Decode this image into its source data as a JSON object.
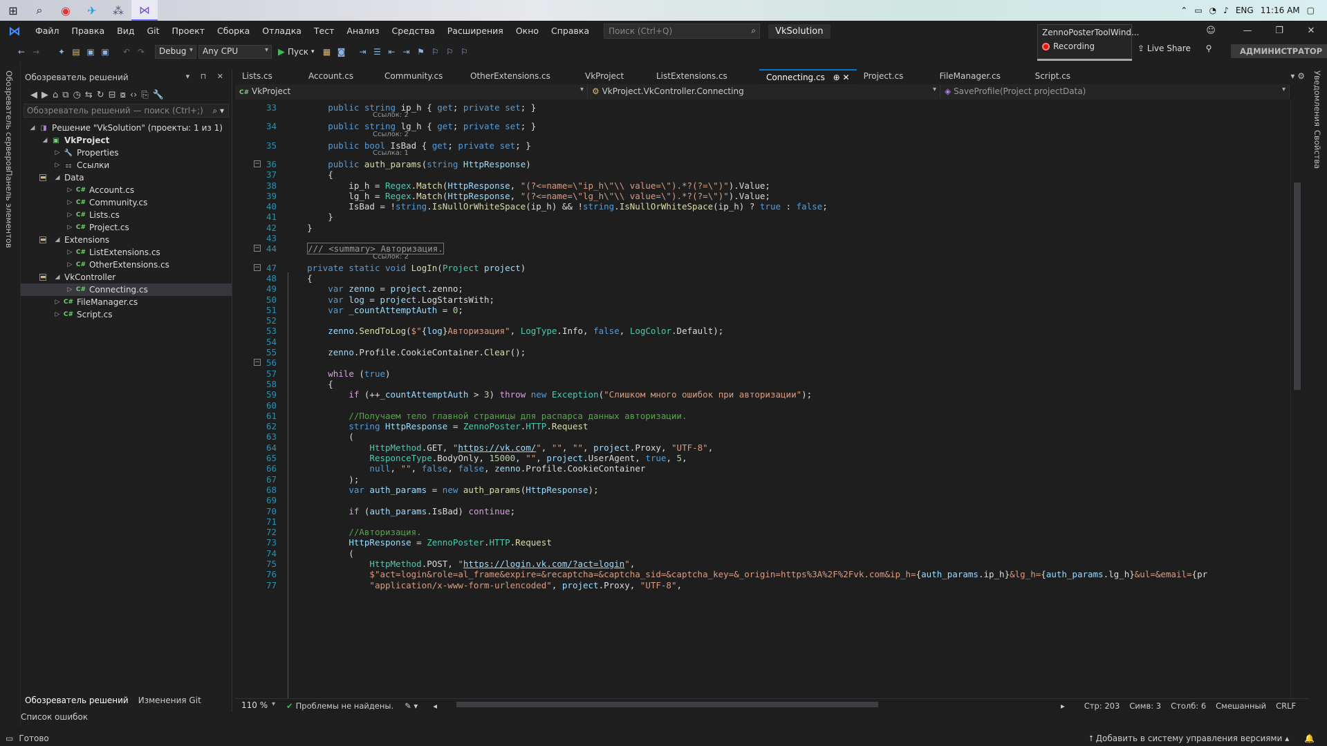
{
  "taskbar": {
    "tray": {
      "lang": "ENG",
      "time": "11:16 AM"
    }
  },
  "menubar": {
    "items": [
      "Файл",
      "Правка",
      "Вид",
      "Git",
      "Проект",
      "Сборка",
      "Отладка",
      "Тест",
      "Анализ",
      "Средства",
      "Расширения",
      "Окно",
      "Справка"
    ],
    "search_placeholder": "Поиск (Ctrl+Q)",
    "solution_name": "VkSolution"
  },
  "recording": {
    "title": "ZennoPosterToolWind...",
    "status": "Recording"
  },
  "toolbar": {
    "config": "Debug",
    "platform": "Any CPU",
    "run_label": "Пуск",
    "live_share": "Live Share",
    "admin": "АДМИНИСТРАТОР"
  },
  "left_strip": {
    "servers": "Обозреватель серверов",
    "toolbox": "Панель элементов"
  },
  "right_strip": {
    "notifications": "Уведомления",
    "properties": "Свойства"
  },
  "solution_explorer": {
    "title": "Обозреватель решений",
    "search_placeholder": "Обозреватель решений — поиск (Ctrl+;)",
    "tree": [
      {
        "label": "Решение \"VkSolution\" (проекты: 1 из 1)",
        "indent": 0,
        "icon": "sol",
        "arrow": "open"
      },
      {
        "label": "VkProject",
        "indent": 1,
        "icon": "proj",
        "arrow": "open",
        "bold": true
      },
      {
        "label": "Properties",
        "indent": 2,
        "icon": "wrench",
        "arrow": "closed"
      },
      {
        "label": "Ссылки",
        "indent": 2,
        "icon": "ref",
        "arrow": "closed"
      },
      {
        "label": "Data",
        "indent": 2,
        "icon": "fold",
        "arrow": "open"
      },
      {
        "label": "Account.cs",
        "indent": 3,
        "icon": "cs",
        "arrow": "closed"
      },
      {
        "label": "Community.cs",
        "indent": 3,
        "icon": "cs",
        "arrow": "closed"
      },
      {
        "label": "Lists.cs",
        "indent": 3,
        "icon": "cs",
        "arrow": "closed"
      },
      {
        "label": "Project.cs",
        "indent": 3,
        "icon": "cs",
        "arrow": "closed"
      },
      {
        "label": "Extensions",
        "indent": 2,
        "icon": "fold",
        "arrow": "open"
      },
      {
        "label": "ListExtensions.cs",
        "indent": 3,
        "icon": "cs",
        "arrow": "closed"
      },
      {
        "label": "OtherExtensions.cs",
        "indent": 3,
        "icon": "cs",
        "arrow": "closed"
      },
      {
        "label": "VkController",
        "indent": 2,
        "icon": "fold",
        "arrow": "open"
      },
      {
        "label": "Connecting.cs",
        "indent": 3,
        "icon": "cs",
        "arrow": "closed",
        "selected": true
      },
      {
        "label": "FileManager.cs",
        "indent": 2,
        "icon": "cs",
        "arrow": "closed"
      },
      {
        "label": "Script.cs",
        "indent": 2,
        "icon": "cs",
        "arrow": "closed"
      }
    ],
    "bottom_tabs": [
      "Обозреватель решений",
      "Изменения Git"
    ],
    "error_list": "Список ошибок"
  },
  "editor": {
    "tabs": [
      "Lists.cs",
      "Account.cs",
      "Community.cs",
      "OtherExtensions.cs",
      "VkProject",
      "ListExtensions.cs",
      "Connecting.cs",
      "Project.cs",
      "FileManager.cs",
      "Script.cs"
    ],
    "active_tab": "Connecting.cs",
    "nav": [
      "VkProject",
      "VkProject.VkController.Connecting",
      "SaveProfile(Project projectData)"
    ],
    "zoom": "110 %",
    "problems": "Проблемы не найдены.",
    "pos": {
      "line": "Стр: 203",
      "char": "Симв: 3",
      "col": "Столб: 6",
      "ws": "Смешанный",
      "eol": "CRLF"
    }
  },
  "code_lines": [
    {
      "n": "33",
      "lens": "Ссылок: 2",
      "html": "        <span class=\"kw\">public</span> <span class=\"kw\">string</span> ip_h { <span class=\"kw\">get</span>; <span class=\"kw\">private</span> <span class=\"kw\">set</span>; }"
    },
    {
      "n": "34",
      "lens": "Ссылок: 2",
      "html": "        <span class=\"kw\">public</span> <span class=\"kw\">string</span> lg_h { <span class=\"kw\">get</span>; <span class=\"kw\">private</span> <span class=\"kw\">set</span>; }"
    },
    {
      "n": "35",
      "lens": "Ссылка: 1",
      "html": "        <span class=\"kw\">public</span> <span class=\"kw\">bool</span> IsBad { <span class=\"kw\">get</span>; <span class=\"kw\">private</span> <span class=\"kw\">set</span>; }"
    },
    {
      "n": "36",
      "html": "        <span class=\"kw\">public</span> <span class=\"fn\">auth_params</span>(<span class=\"kw\">string</span> <span class=\"vr\">HttpResponse</span>)"
    },
    {
      "n": "37",
      "html": "        {"
    },
    {
      "n": "38",
      "html": "            ip_h = <span class=\"ty\">Regex</span>.<span class=\"fn\">Match</span>(<span class=\"vr\">HttpResponse</span>, <span class=\"st\">\"(?&lt;=name=\\\"ip_h\\\"\\\\ value=\\\").*?(?=\\\")\"</span>).Value;"
    },
    {
      "n": "39",
      "html": "            lg_h = <span class=\"ty\">Regex</span>.<span class=\"fn\">Match</span>(<span class=\"vr\">HttpResponse</span>, <span class=\"st\">\"(?&lt;=name=\\\"lg_h\\\"\\\\ value=\\\").*?(?=\\\")\"</span>).Value;"
    },
    {
      "n": "40",
      "html": "            IsBad = !<span class=\"kw\">string</span>.<span class=\"fn\">IsNullOrWhiteSpace</span>(ip_h) &amp;&amp; !<span class=\"kw\">string</span>.<span class=\"fn\">IsNullOrWhiteSpace</span>(ip_h) ? <span class=\"kw\">true</span> : <span class=\"kw\">false</span>;"
    },
    {
      "n": "41",
      "html": "        }"
    },
    {
      "n": "42",
      "html": "    }"
    },
    {
      "n": "43",
      "html": ""
    },
    {
      "n": "44",
      "lens": "Ссылок: 2",
      "html": "    <span style=\"border:1px solid #777;color:#999\">/// &lt;summary&gt; Авторизация.</span>"
    },
    {
      "n": "47",
      "html": "    <span class=\"kw\">private</span> <span class=\"kw\">static</span> <span class=\"kw\">void</span> <span class=\"fn\">LogIn</span>(<span class=\"ty\">Project</span> <span class=\"vr\">project</span>)"
    },
    {
      "n": "48",
      "html": "    {"
    },
    {
      "n": "49",
      "html": "        <span class=\"kw\">var</span> <span class=\"vr\">zenno</span> = <span class=\"vr\">project</span>.zenno;"
    },
    {
      "n": "50",
      "html": "        <span class=\"kw\">var</span> <span class=\"vr\">log</span> = <span class=\"vr\">project</span>.LogStartsWith;"
    },
    {
      "n": "51",
      "html": "        <span class=\"kw\">var</span> <span class=\"vr\">_countAttemptAuth</span> = <span class=\"nm\">0</span>;"
    },
    {
      "n": "52",
      "html": ""
    },
    {
      "n": "53",
      "html": "        <span class=\"vr\">zenno</span>.<span class=\"fn\">SendToLog</span>(<span class=\"st\">$\"</span>{<span class=\"vr\">log</span>}<span class=\"st\">Авторизация\"</span>, <span class=\"ty\">LogType</span>.Info, <span class=\"kw\">false</span>, <span class=\"ty\">LogColor</span>.Default);"
    },
    {
      "n": "54",
      "html": ""
    },
    {
      "n": "55",
      "html": "        <span class=\"vr\">zenno</span>.Profile.CookieContainer.<span class=\"fn\">Clear</span>();"
    },
    {
      "n": "56",
      "html": ""
    },
    {
      "n": "57",
      "html": "        <span class=\"ctl\">while</span> (<span class=\"kw\">true</span>)"
    },
    {
      "n": "58",
      "html": "        {"
    },
    {
      "n": "59",
      "html": "            <span class=\"ctl\">if</span> (++<span class=\"vr\">_countAttemptAuth</span> &gt; <span class=\"nm\">3</span>) <span class=\"ctl\">throw</span> <span class=\"kw\">new</span> <span class=\"ty\">Exception</span>(<span class=\"st\">\"Слишком много ошибок при авторизации\"</span>);"
    },
    {
      "n": "60",
      "html": ""
    },
    {
      "n": "61",
      "html": "            <span class=\"cm\">//Получаем тело главной страницы для распарса данных авторизации.</span>"
    },
    {
      "n": "62",
      "html": "            <span class=\"kw\">string</span> <span class=\"vr\">HttpResponse</span> = <span class=\"ty\">ZennoPoster</span>.<span class=\"ty\">HTTP</span>.<span class=\"fn\">Request</span>"
    },
    {
      "n": "63",
      "html": "            ("
    },
    {
      "n": "64",
      "html": "                <span class=\"ty\">HttpMethod</span>.GET, <span class=\"st\">\"</span><span class=\"lk\">https://vk.com/</span><span class=\"st\">\"</span>, <span class=\"st\">\"\"</span>, <span class=\"st\">\"\"</span>, <span class=\"vr\">project</span>.Proxy, <span class=\"st\">\"UTF-8\"</span>,"
    },
    {
      "n": "65",
      "html": "                <span class=\"ty\">ResponceType</span>.BodyOnly, <span class=\"nm\">15000</span>, <span class=\"st\">\"\"</span>, <span class=\"vr\">project</span>.UserAgent, <span class=\"kw\">true</span>, <span class=\"nm\">5</span>,"
    },
    {
      "n": "66",
      "html": "                <span class=\"kw\">null</span>, <span class=\"st\">\"\"</span>, <span class=\"kw\">false</span>, <span class=\"kw\">false</span>, <span class=\"vr\">zenno</span>.Profile.CookieContainer"
    },
    {
      "n": "67",
      "html": "            );"
    },
    {
      "n": "68",
      "html": "            <span class=\"kw\">var</span> <span class=\"vr\">auth_params</span> = <span class=\"kw\">new</span> <span class=\"fn\">auth_params</span>(<span class=\"vr\">HttpResponse</span>);"
    },
    {
      "n": "69",
      "html": ""
    },
    {
      "n": "70",
      "html": "            <span class=\"ctl\">if</span> (<span class=\"vr\">auth_params</span>.IsBad) <span class=\"ctl\">continue</span>;"
    },
    {
      "n": "71",
      "html": ""
    },
    {
      "n": "72",
      "html": "            <span class=\"cm\">//Авторизация.</span>"
    },
    {
      "n": "73",
      "html": "            <span class=\"vr\">HttpResponse</span> = <span class=\"ty\">ZennoPoster</span>.<span class=\"ty\">HTTP</span>.<span class=\"fn\">Request</span>"
    },
    {
      "n": "74",
      "html": "            ("
    },
    {
      "n": "75",
      "html": "                <span class=\"ty\">HttpMethod</span>.POST, <span class=\"st\">\"</span><span class=\"lk\">https://login.vk.com/?act=login</span><span class=\"st\">\"</span>,"
    },
    {
      "n": "76",
      "html": "                <span class=\"st\">$\"act=login&amp;role=al_frame&amp;expire=&amp;recaptcha=&amp;captcha_sid=&amp;captcha_key=&amp;_origin=https%3A%2F%2Fvk.com&amp;ip_h=</span>{<span class=\"vr\">auth_params</span>.ip_h}<span class=\"st\">&amp;lg_h=</span>{<span class=\"vr\">auth_params</span>.lg_h}<span class=\"st\">&amp;ul=&amp;email=</span>{pr"
    },
    {
      "n": "77",
      "html": "                <span class=\"st\">\"application/x-www-form-urlencoded\"</span>, <span class=\"vr\">project</span>.Proxy, <span class=\"st\">\"UTF-8\"</span>,"
    }
  ],
  "status": {
    "ready": "Готово",
    "vcs": "Добавить в систему управления версиями"
  }
}
